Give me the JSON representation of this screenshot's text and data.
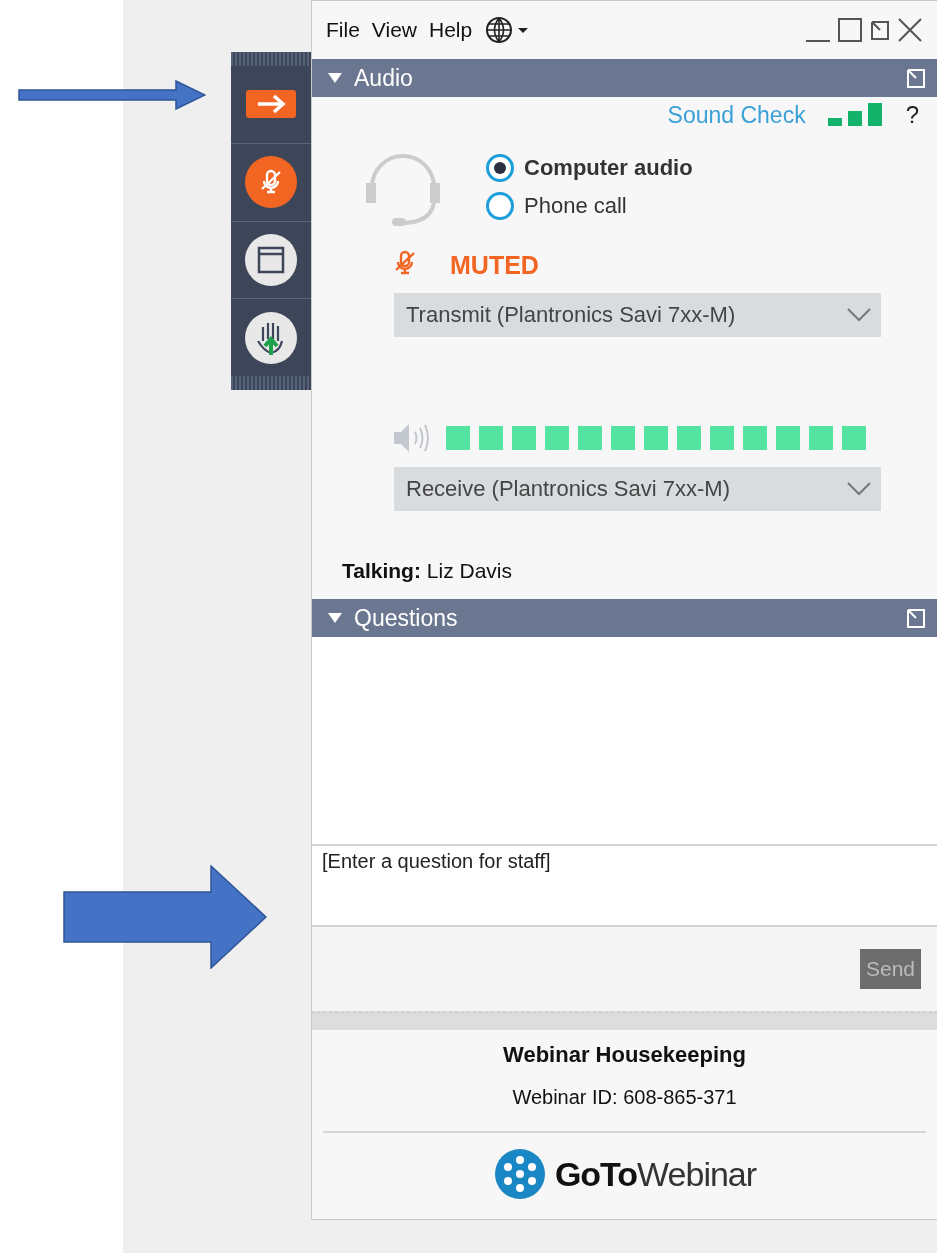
{
  "menu": [
    {
      "label": "File"
    },
    {
      "label": "View"
    },
    {
      "label": "Help"
    }
  ],
  "toolbar": {
    "muted": true
  },
  "audio": {
    "title": "Audio",
    "sound_check": "Sound Check",
    "help": "?",
    "modes": [
      {
        "label": "Computer audio",
        "selected": true
      },
      {
        "label": "Phone call",
        "selected": false
      }
    ],
    "muted": true,
    "muted_label": "MUTED",
    "transmit": "Transmit (Plantronics Savi 7xx-M)",
    "speaker": {
      "level": 1
    },
    "receive": "Receive (Plantronics Savi 7xx-M)",
    "talking": "**Talking:** Liz Davis"
  },
  "questions": {
    "title": "Questions",
    "placeholder": "[Enter a question for staff]",
    "send": {
      "label": "Send",
      "disabled": true
    }
  },
  "footer": {
    "title": "Webinar Housekeeping",
    "webinar_id": "Webinar ID: 608-865-371",
    "logo": "**GoTo**Webinar"
  }
}
